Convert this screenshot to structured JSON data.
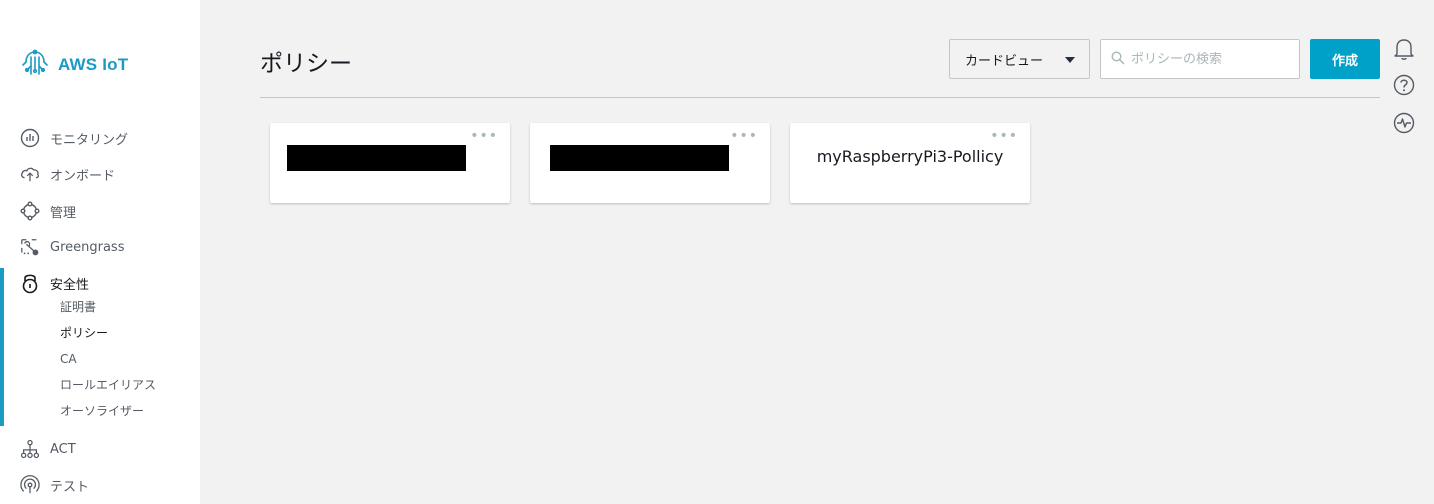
{
  "brand": {
    "name": "AWS IoT"
  },
  "sidebar": {
    "items": [
      {
        "label": "モニタリング",
        "icon": "monitoring-icon"
      },
      {
        "label": "オンボード",
        "icon": "onboard-icon"
      },
      {
        "label": "管理",
        "icon": "manage-icon"
      },
      {
        "label": "Greengrass",
        "icon": "greengrass-icon"
      },
      {
        "label": "安全性",
        "icon": "lock-icon"
      },
      {
        "label": "ACT",
        "icon": "act-icon"
      },
      {
        "label": "テスト",
        "icon": "test-icon"
      }
    ],
    "security_sub": [
      {
        "label": "証明書"
      },
      {
        "label": "ポリシー"
      },
      {
        "label": "CA"
      },
      {
        "label": "ロールエイリアス"
      },
      {
        "label": "オーソライザー"
      }
    ],
    "accent_color": "#1a9bc4"
  },
  "header": {
    "title": "ポリシー",
    "view_select": "カードビュー",
    "search_placeholder": "ポリシーの検索",
    "create_label": "作成",
    "create_color": "#00a1c9"
  },
  "right_icons": [
    "bell-icon",
    "help-icon",
    "activity-icon"
  ],
  "cards": [
    {
      "name": "",
      "redacted": true
    },
    {
      "name": "",
      "redacted": true
    },
    {
      "name": "myRaspberryPi3-Pollicy",
      "redacted": false
    }
  ],
  "card_menu": "•••"
}
